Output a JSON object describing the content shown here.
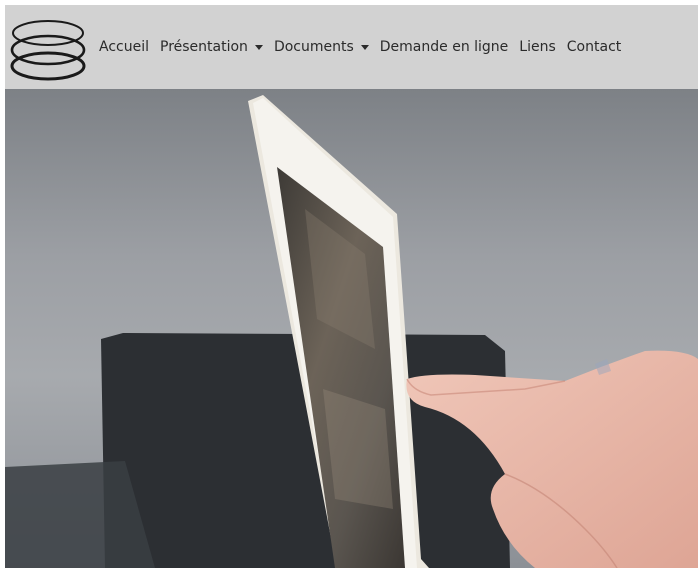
{
  "nav": {
    "items": [
      {
        "label": "Accueil",
        "dropdown": false
      },
      {
        "label": "Présentation",
        "dropdown": true
      },
      {
        "label": "Documents",
        "dropdown": true
      },
      {
        "label": "Demande en ligne",
        "dropdown": false
      },
      {
        "label": "Liens",
        "dropdown": false
      },
      {
        "label": "Contact",
        "dropdown": false
      }
    ]
  },
  "icons": {
    "logo": "three-stacked-ellipses-logo",
    "dropdown": "caret-down-icon"
  },
  "colors": {
    "navbar_bg": "#d2d2d2",
    "nav_text": "#2b2b2b"
  },
  "hero": {
    "image": "hand-touching-tablet-screen"
  }
}
